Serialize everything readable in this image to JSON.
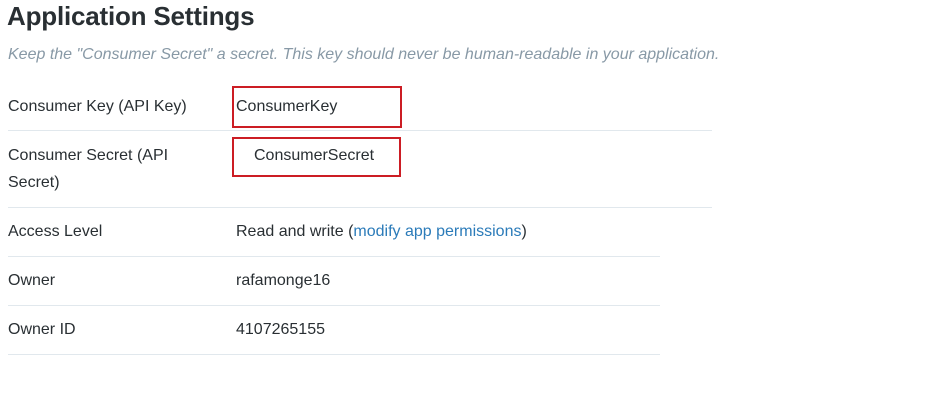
{
  "header": {
    "title": "Application Settings",
    "subtitle": "Keep the \"Consumer Secret\" a secret. This key should never be human-readable in your application."
  },
  "settings": {
    "consumer_key": {
      "label": "Consumer Key (API Key)",
      "value": "ConsumerKey"
    },
    "consumer_secret": {
      "label_line1": "Consumer Secret (API",
      "label_line2": "Secret)",
      "value": "ConsumerSecret"
    },
    "access_level": {
      "label": "Access Level",
      "value": "Read and write",
      "paren_open": " (",
      "link": "modify app permissions",
      "paren_close": ")"
    },
    "owner": {
      "label": "Owner",
      "value": "rafamonge16"
    },
    "owner_id": {
      "label": "Owner ID",
      "value": "4107265155"
    }
  },
  "colors": {
    "highlight_border": "#cc1d24",
    "link": "#2b7bb9",
    "subtitle": "#8899a6",
    "divider": "#e1e8ed"
  }
}
